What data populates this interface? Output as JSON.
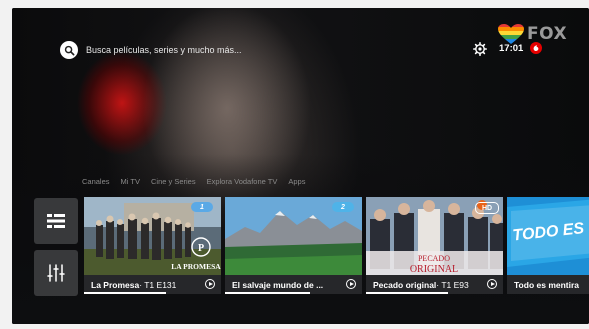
{
  "search": {
    "placeholder": "Busca películas, series y mucho más..."
  },
  "status": {
    "time": "17:01"
  },
  "channel": {
    "logo_text": "FOX"
  },
  "nav": {
    "items": [
      "Canales",
      "Mi TV",
      "Cine y Series",
      "Explora Vodafone TV",
      "Apps"
    ]
  },
  "side_buttons": {
    "top_icon": "guide-list-icon",
    "bottom_icon": "settings-sliders-icon"
  },
  "cards": [
    {
      "title": "La Promesa",
      "episode": " · T1 E131",
      "badge": "1",
      "art_text": "LA PROMESA",
      "progress": 0.6
    },
    {
      "title": "El salvaje mundo de ...",
      "episode": "",
      "badge": "2",
      "progress": 0.62
    },
    {
      "title": "Pecado original",
      "episode": " · T1 E93",
      "badge": "HD",
      "art_text_1": "PECADO",
      "art_text_2": "ORIGINAL",
      "progress": 0.6
    },
    {
      "title": "Todo es mentira",
      "episode": "",
      "art_text": "TODO ES MENT",
      "progress": 0
    }
  ],
  "colors": {
    "vodafone_red": "#e60000",
    "card_bg": "#26272a",
    "side_button_bg": "#38393b"
  }
}
